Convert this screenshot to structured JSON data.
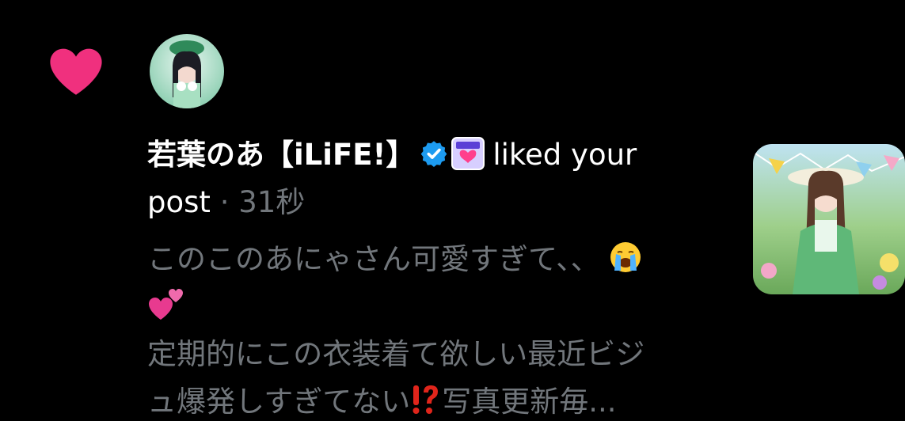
{
  "notification": {
    "type": "like",
    "actor_name": "若葉のあ【iLiFE!】",
    "action_text": "liked your post",
    "action_text_line1": "liked your",
    "action_text_line2": "post",
    "separator": "·",
    "timestamp": "31秒",
    "preview_line1": "このこのあにゃさん可愛すぎて、、",
    "preview_line2": "定期的にこの衣装着て欲しい最近ビジ",
    "preview_line3_start": "ュ爆発しすぎてない",
    "preview_line3_end": "写真更新毎...",
    "icons": {
      "like": "heart-icon",
      "verified": "verified-badge-icon",
      "affiliation": "ilife-affiliation-badge-icon",
      "emoji1": "loudly-crying-face-emoji",
      "emoji2": "two-hearts-emoji",
      "emoji3": "exclamation-question-mark-emoji"
    }
  },
  "colors": {
    "background": "#000000",
    "heart": "#f91880",
    "verified": "#1d9bf0",
    "text_primary": "#ffffff",
    "text_secondary": "#71767b"
  }
}
